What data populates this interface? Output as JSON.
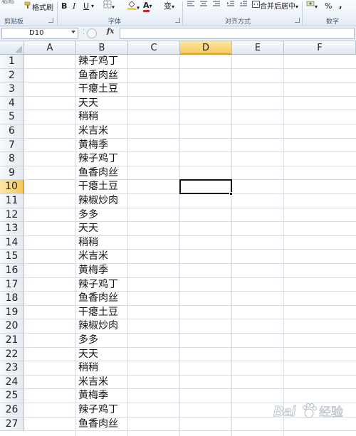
{
  "ribbon": {
    "paste_label_partial": "粘贴",
    "format_painter_label": "格式刷",
    "bold": "B",
    "italic": "I",
    "underline": "U",
    "font_color_letter": "A",
    "pinyin_label": "变",
    "merge_center_label": "合并后居中",
    "percent": "%",
    "comma": ",",
    "groups": {
      "clipboard": "剪贴板",
      "font": "字体",
      "alignment": "对齐方式",
      "number": "数字"
    },
    "colors": {
      "fill_color": "#f7d11b",
      "font_color": "#d9261c"
    }
  },
  "formula_bar": {
    "name_box": "D10",
    "fx_label": "fx",
    "formula_value": ""
  },
  "grid": {
    "columns": [
      "A",
      "B",
      "C",
      "D",
      "E",
      "F"
    ],
    "selected_column": "D",
    "rows": [
      {
        "n": "1",
        "b": "辣子鸡丁"
      },
      {
        "n": "2",
        "b": "鱼香肉丝"
      },
      {
        "n": "3",
        "b": "干瘪土豆"
      },
      {
        "n": "4",
        "b": "天天"
      },
      {
        "n": "5",
        "b": "稍稍"
      },
      {
        "n": "6",
        "b": "米吉米"
      },
      {
        "n": "7",
        "b": "黄梅季"
      },
      {
        "n": "8",
        "b": "辣子鸡丁"
      },
      {
        "n": "9",
        "b": "鱼香肉丝"
      },
      {
        "n": "10",
        "b": "干瘪土豆"
      },
      {
        "n": "11",
        "b": "辣椒炒肉"
      },
      {
        "n": "12",
        "b": "多多"
      },
      {
        "n": "13",
        "b": "天天"
      },
      {
        "n": "14",
        "b": "稍稍"
      },
      {
        "n": "15",
        "b": "米吉米"
      },
      {
        "n": "16",
        "b": "黄梅季"
      },
      {
        "n": "17",
        "b": "辣子鸡丁"
      },
      {
        "n": "18",
        "b": "鱼香肉丝"
      },
      {
        "n": "19",
        "b": "干瘪土豆"
      },
      {
        "n": "20",
        "b": "辣椒炒肉"
      },
      {
        "n": "21",
        "b": "多多"
      },
      {
        "n": "22",
        "b": "天天"
      },
      {
        "n": "23",
        "b": "稍稍"
      },
      {
        "n": "24",
        "b": "米吉米"
      },
      {
        "n": "25",
        "b": "黄梅季"
      },
      {
        "n": "26",
        "b": "辣子鸡丁"
      },
      {
        "n": "27",
        "b": "鱼香肉丝"
      }
    ],
    "selected_row": "10",
    "accent_color": "#f6c85d"
  },
  "watermark": {
    "text": "Bai",
    "icon": "baidu-paw-icon",
    "suffix": "经验"
  }
}
